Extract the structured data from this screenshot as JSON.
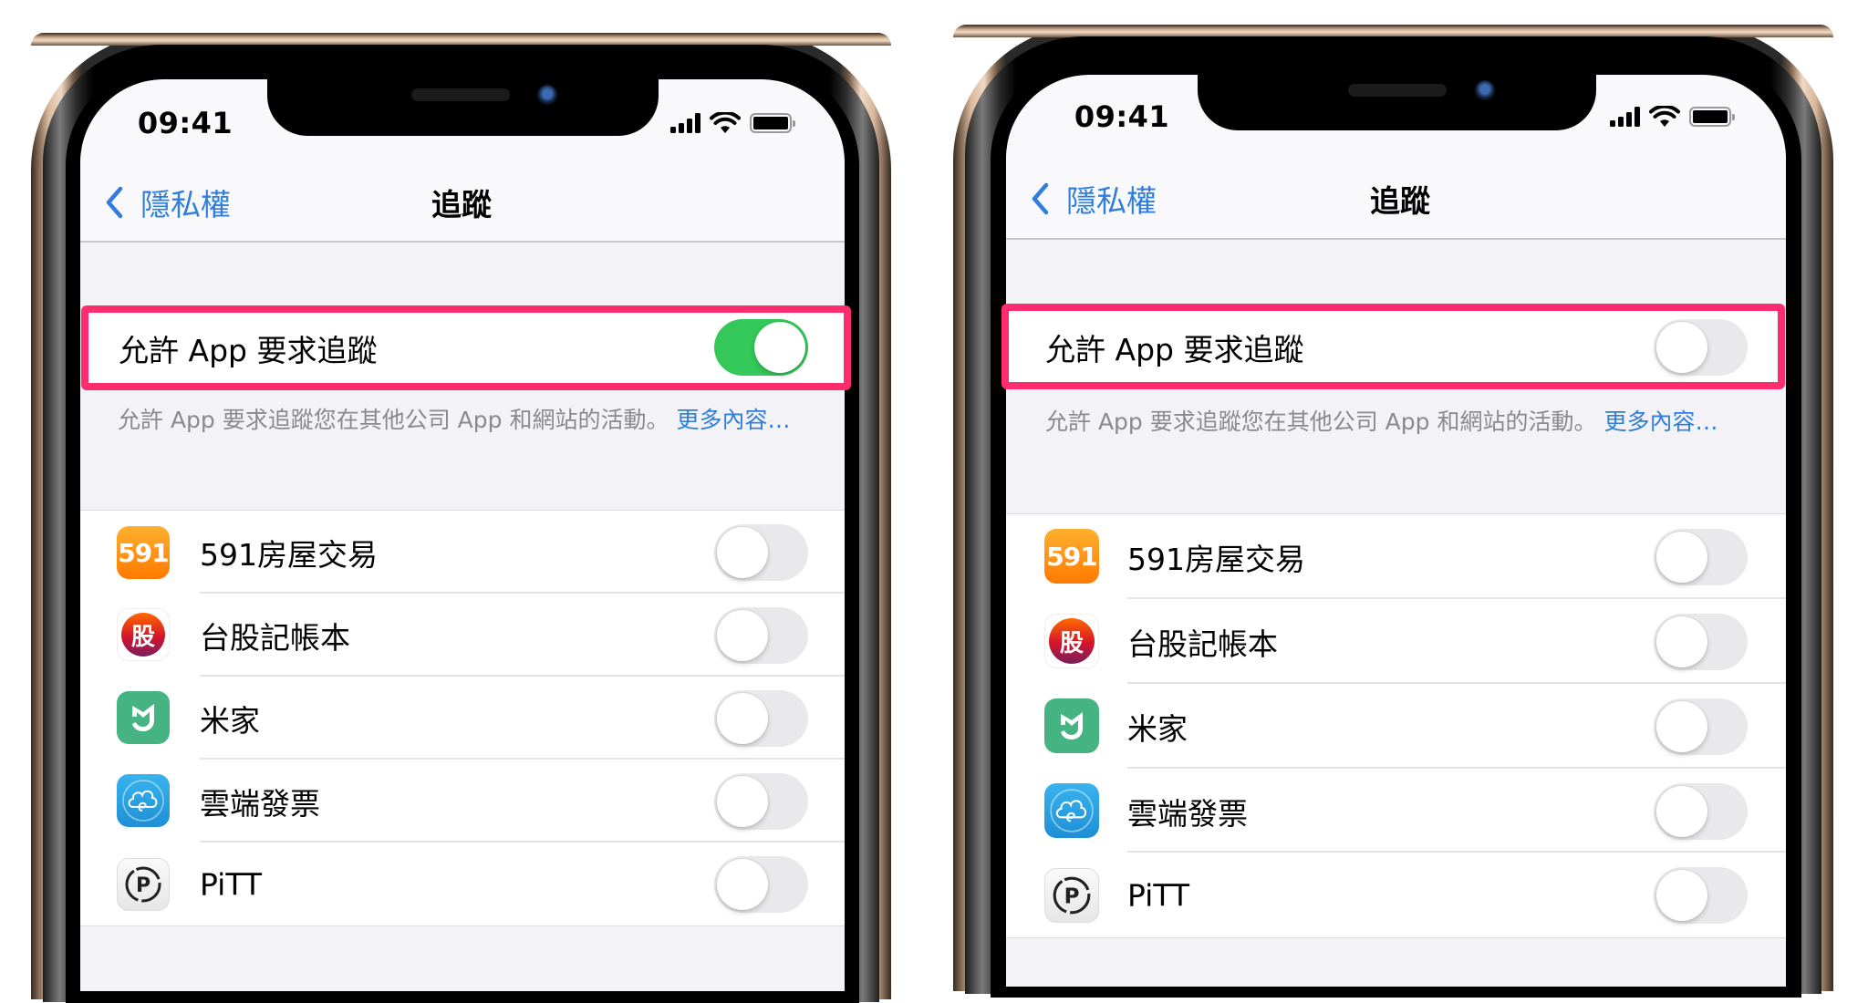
{
  "phones": [
    {
      "status_bar": {
        "time": "09:41"
      },
      "nav": {
        "back_label": "隱私權",
        "title": "追蹤"
      },
      "main_setting": {
        "label": "允許 App 要求追蹤",
        "enabled": true
      },
      "footer": {
        "text": "允許 App 要求追蹤您在其他公司 App 和網站的活動。",
        "link": "更多內容…"
      },
      "apps": [
        {
          "name": "591房屋交易",
          "icon": "591-app-icon",
          "icon_text": "591",
          "enabled": false
        },
        {
          "name": "台股記帳本",
          "icon": "stock-app-icon",
          "icon_text": "股",
          "enabled": false
        },
        {
          "name": "米家",
          "icon": "mijia-app-icon",
          "enabled": false
        },
        {
          "name": "雲端發票",
          "icon": "cloud-invoice-app-icon",
          "enabled": false
        },
        {
          "name": "PiTT",
          "icon": "pitt-app-icon",
          "icon_text": "P",
          "enabled": false
        }
      ]
    },
    {
      "status_bar": {
        "time": "09:41"
      },
      "nav": {
        "back_label": "隱私權",
        "title": "追蹤"
      },
      "main_setting": {
        "label": "允許 App 要求追蹤",
        "enabled": false
      },
      "footer": {
        "text": "允許 App 要求追蹤您在其他公司 App 和網站的活動。",
        "link": "更多內容…"
      },
      "apps": [
        {
          "name": "591房屋交易",
          "icon": "591-app-icon",
          "icon_text": "591",
          "enabled": false
        },
        {
          "name": "台股記帳本",
          "icon": "stock-app-icon",
          "icon_text": "股",
          "enabled": false
        },
        {
          "name": "米家",
          "icon": "mijia-app-icon",
          "enabled": false
        },
        {
          "name": "雲端發票",
          "icon": "cloud-invoice-app-icon",
          "enabled": false
        },
        {
          "name": "PiTT",
          "icon": "pitt-app-icon",
          "icon_text": "P",
          "enabled": false
        }
      ]
    }
  ],
  "colors": {
    "highlight": "#ff2d6f",
    "toggle_on": "#34c759",
    "toggle_off": "#e9e9eb",
    "link": "#2f7ddc"
  }
}
